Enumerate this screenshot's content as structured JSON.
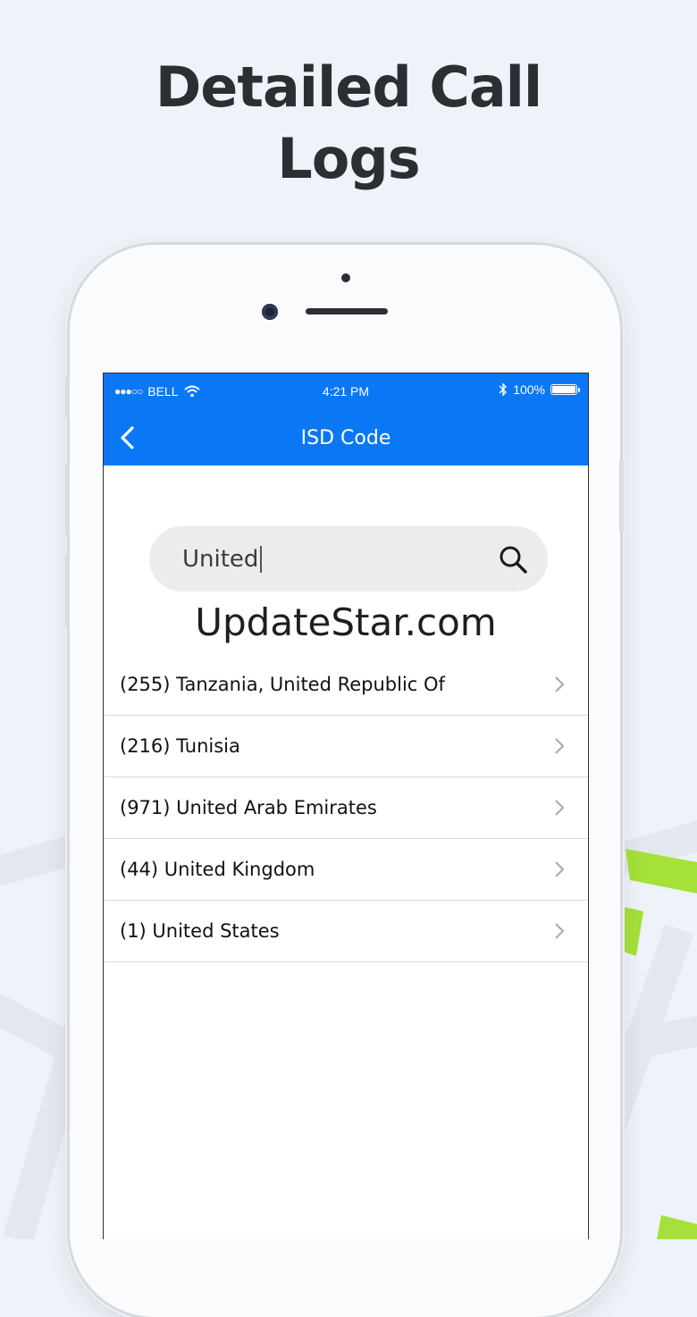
{
  "headline": {
    "line1": "Detailed Call",
    "line2": "Logs"
  },
  "colors": {
    "accent": "#0a78f5",
    "background": "#eef3fa",
    "map_green": "#a6e03a"
  },
  "statusbar": {
    "signal": "●●●○○",
    "carrier": "BELL",
    "time": "4:21 PM",
    "battery": "100%"
  },
  "navbar": {
    "title": "ISD Code",
    "back_icon": "chevron-left-icon"
  },
  "search": {
    "value": "United",
    "icon": "search-icon"
  },
  "watermark": "UpdateStar.com",
  "results": [
    {
      "label": "(255) Tanzania, United Republic Of"
    },
    {
      "label": "(216) Tunisia"
    },
    {
      "label": "(971) United Arab Emirates"
    },
    {
      "label": "(44) United Kingdom"
    },
    {
      "label": "(1) United States"
    }
  ]
}
